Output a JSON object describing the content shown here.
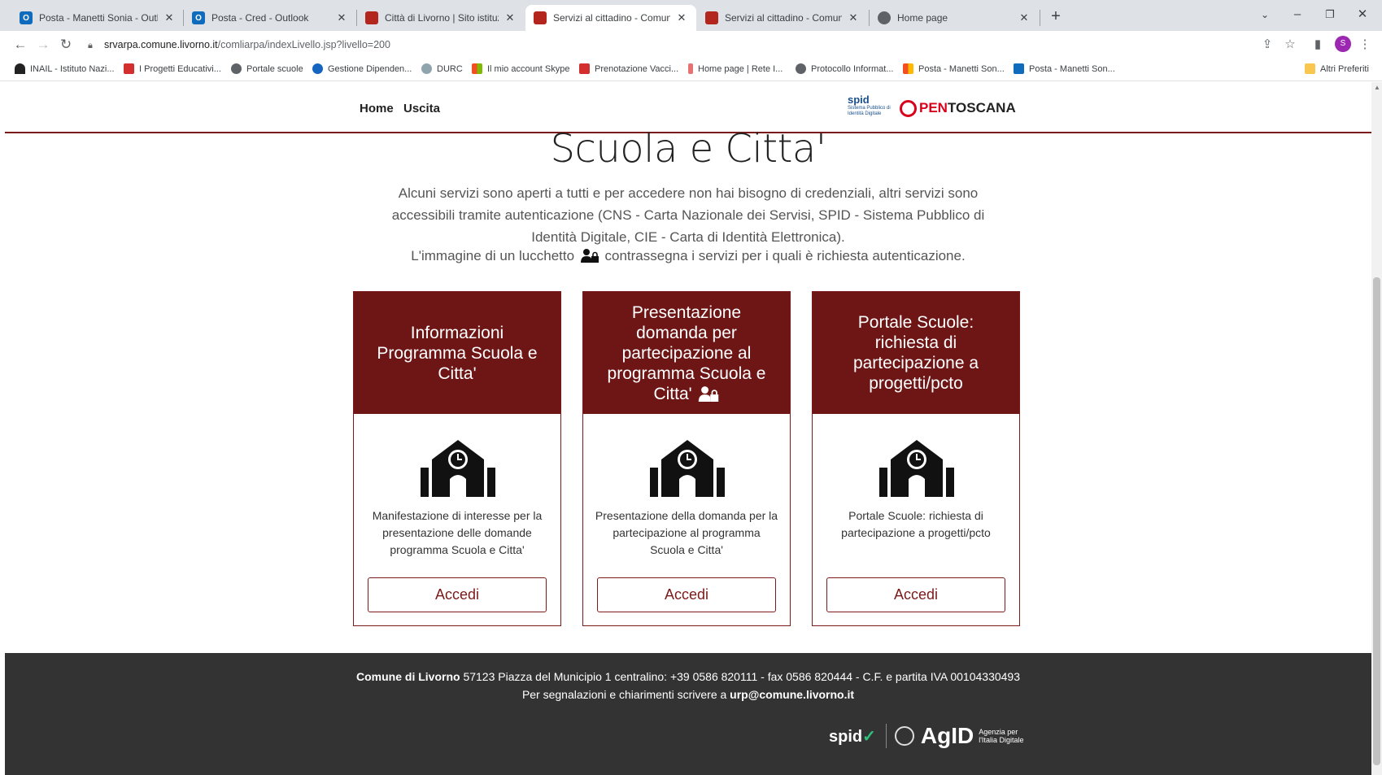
{
  "browser": {
    "tabs": [
      {
        "title": "Posta - Manetti Sonia - Outlook",
        "icon": "outlook-icon",
        "color": "#0f6cbd"
      },
      {
        "title": "Posta - Cred - Outlook",
        "icon": "outlook-icon",
        "color": "#0f6cbd"
      },
      {
        "title": "Città di Livorno | Sito istituzionale",
        "icon": "livorno-crest-icon",
        "color": "#b3261e"
      },
      {
        "title": "Servizi al cittadino - Comune di L",
        "icon": "livorno-crest-icon",
        "color": "#b3261e"
      },
      {
        "title": "Servizi al cittadino - Comune di L",
        "icon": "livorno-crest-icon",
        "color": "#b3261e"
      },
      {
        "title": "Home page",
        "icon": "globe-icon",
        "color": "#5f6368"
      }
    ],
    "url_host": "srvarpa.comune.livorno.it",
    "url_path": "/comliarpa/indexLivello.jsp?livello=200",
    "profile_initial": "S",
    "bookmarks": [
      "INAIL - Istituto Nazi...",
      "I Progetti Educativi...",
      "Portale scuole",
      "Gestione Dipenden...",
      "DURC",
      "Il mio account Skype",
      "Prenotazione Vacci...",
      "Home page | Rete I...",
      "Protocollo Informat...",
      "Posta - Manetti Son...",
      "Posta - Manetti Son..."
    ],
    "other_bookmarks": "Altri Preferiti"
  },
  "site": {
    "nav": {
      "home": "Home",
      "exit": "Uscita"
    },
    "spid_logo": "spid",
    "spid_sub": "Sistema Pubblico di Identità Digitale",
    "open_logo_a": "PEN",
    "open_logo_b": "TOSCANA",
    "title": "Scuola e Citta'",
    "intro": "Alcuni servizi sono aperti a tutti e per accedere non hai bisogno di credenziali, altri servizi sono accessibili tramite autenticazione (CNS - Carta Nazionale dei Servisi, SPID - Sistema Pubblico di Identità Digitale, CIE - Carta di Identità Elettronica).",
    "intro2_a": "L'immagine di un lucchetto",
    "intro2_b": "contrassegna i servizi per i quali è richiesta autenticazione.",
    "cards": [
      {
        "title": "Informazioni Programma Scuola e Citta'",
        "desc": "Manifestazione di interesse per la presentazione delle domande programma Scuola e Citta'",
        "button": "Accedi",
        "locked": false
      },
      {
        "title": "Presentazione domanda per partecipazione al programma Scuola e Citta'",
        "desc": "Presentazione della domanda per la partecipazione al programma Scuola e Citta'",
        "button": "Accedi",
        "locked": true
      },
      {
        "title": "Portale Scuole: richiesta di partecipazione a progetti/pcto",
        "desc": "Portale Scuole: richiesta di partecipazione a progetti/pcto",
        "button": "Accedi",
        "locked": false
      }
    ],
    "footer": {
      "org": "Comune di Livorno",
      "address": "57123 Piazza del Municipio 1 centralino: +39 0586 820111 - fax 0586 820444 - C.F. e partita IVA 00104330493",
      "contact_text": "Per segnalazioni e chiarimenti scrivere a",
      "email": "urp@comune.livorno.it",
      "spid_logo": "spid",
      "agid_logo": "AgID",
      "agid_sub_1": "Agenzia per",
      "agid_sub_2": "l'Italia Digitale"
    }
  },
  "colors": {
    "brand": "#6e1616",
    "footer_bg": "#333333"
  }
}
